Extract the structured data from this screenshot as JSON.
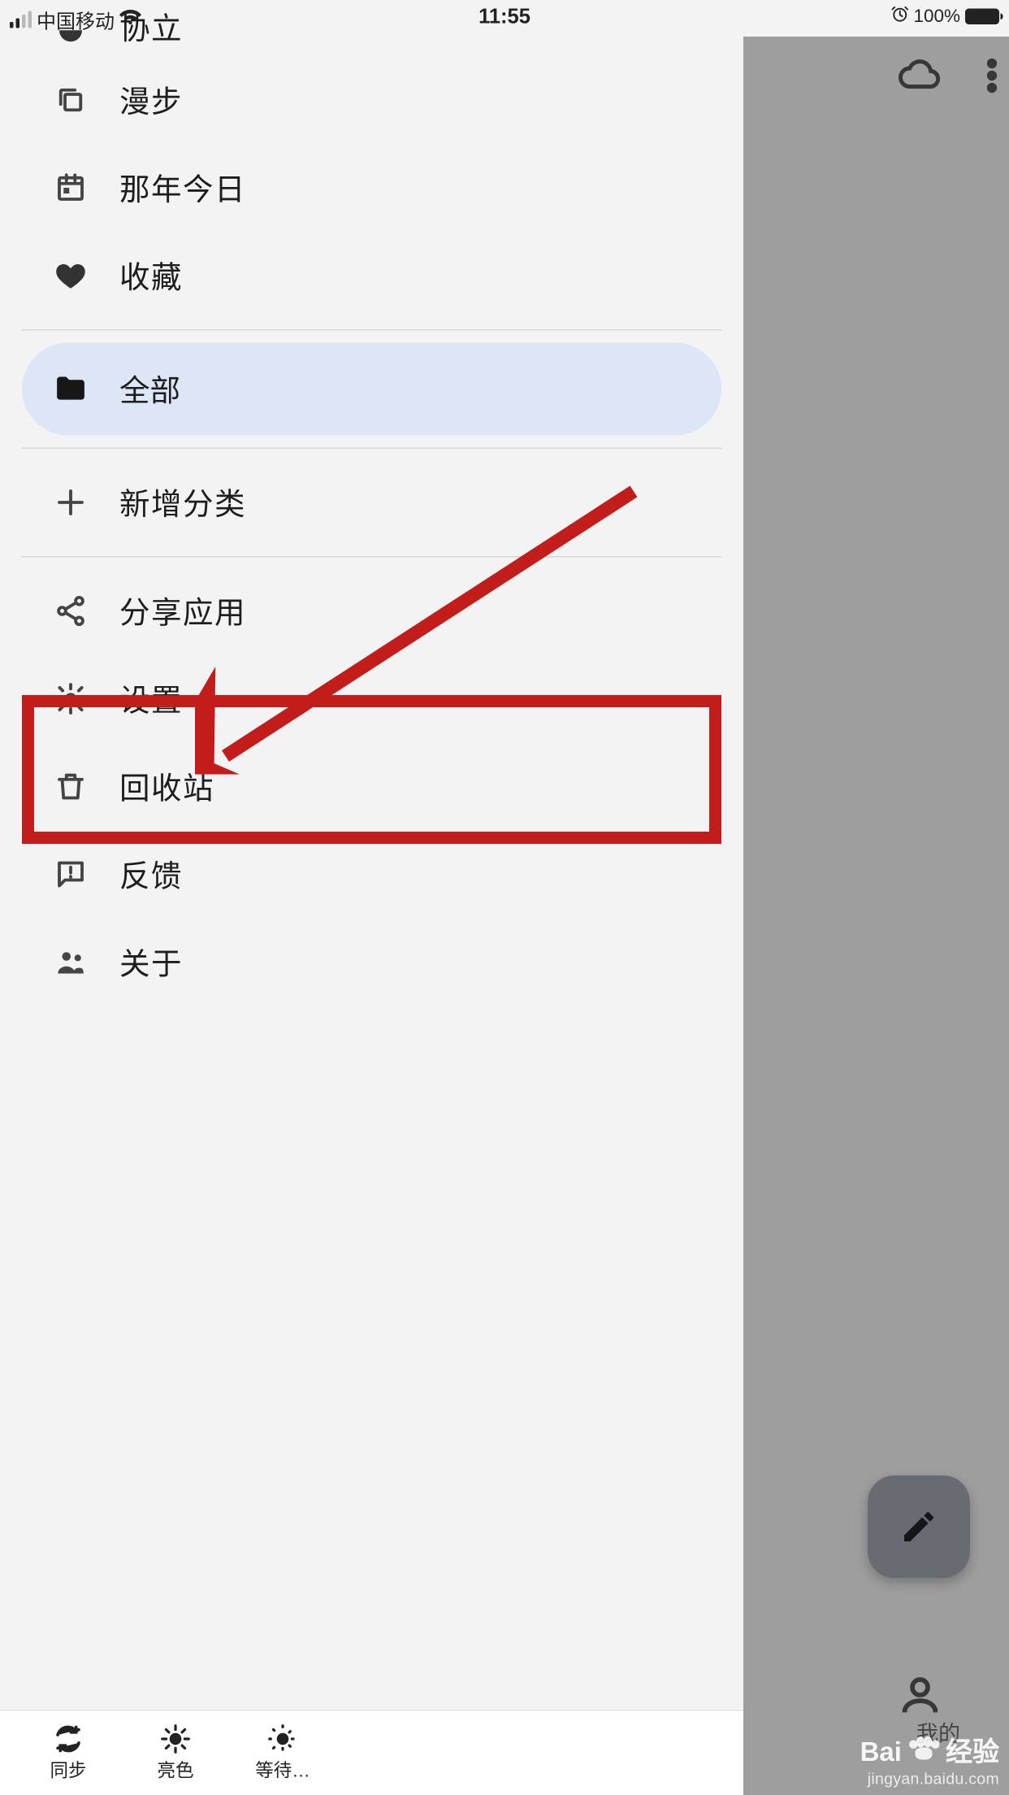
{
  "status": {
    "carrier": "中国移动",
    "time": "11:55",
    "battery_pct": "100%"
  },
  "drawer": {
    "items": {
      "partial": "协立",
      "walk": "漫步",
      "thatday": "那年今日",
      "fav": "收藏",
      "all": "全部",
      "addcat": "新增分类",
      "share": "分享应用",
      "settings": "设置",
      "recycle": "回收站",
      "feedback": "反馈",
      "about": "关于"
    }
  },
  "bottombar": {
    "sync": "同步",
    "light": "亮色",
    "wait": "等待…"
  },
  "backdrop": {
    "person_label": "我的"
  },
  "watermark": {
    "brand_prefix": "Bai",
    "brand_suffix": "经验",
    "url": "jingyan.baidu.com"
  }
}
